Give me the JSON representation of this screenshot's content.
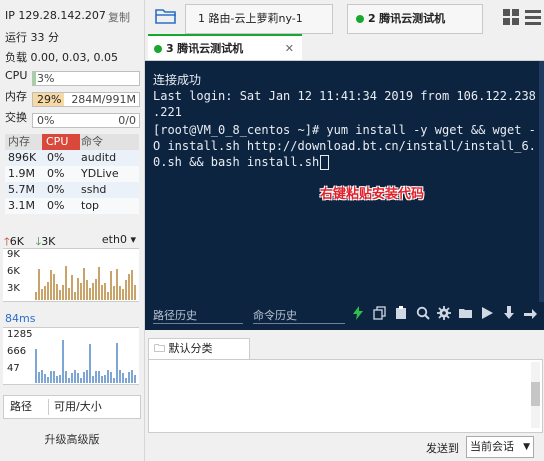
{
  "sidebar": {
    "ip_label": "IP 129.28.142.207",
    "copy_label": "复制",
    "uptime": "运行 33 分",
    "load": "负载 0.00, 0.03, 0.05",
    "cpu_label": "CPU",
    "cpu_value": "3%",
    "cpu_pct": 3,
    "mem_label": "内存",
    "mem_pct_text": "29%",
    "mem_pct": 29,
    "mem_size": "284M/991M",
    "swap_label": "交换",
    "swap_pct_text": "0%",
    "swap_size": "0/0",
    "proc_headers": [
      "内存",
      "CPU",
      "命令"
    ],
    "processes": [
      {
        "mem": "896K",
        "cpu": "0%",
        "cmd": "auditd"
      },
      {
        "mem": "1.9M",
        "cpu": "0%",
        "cmd": "YDLive"
      },
      {
        "mem": "5.7M",
        "cpu": "0%",
        "cmd": "sshd"
      },
      {
        "mem": "3.1M",
        "cpu": "0%",
        "cmd": "top"
      }
    ],
    "net_up": "6K",
    "net_down": "3K",
    "net_iface": "eth0",
    "net_ticks": [
      "9K",
      "6K",
      "3K"
    ],
    "latency_label": "84ms",
    "latency_ticks": [
      "1285",
      "666",
      "47"
    ],
    "disk_col1": "路径",
    "disk_col2": "可用/大小",
    "upgrade": "升级高级版"
  },
  "tabs": [
    {
      "number": "1",
      "label": "路由-云上萝莉ny-1",
      "active": false
    },
    {
      "number": "2",
      "label": "腾讯云测试机",
      "active": false
    }
  ],
  "active_tab": {
    "number": "3",
    "label": "腾讯云测试机"
  },
  "terminal": {
    "lines": [
      "连接成功",
      "Last login: Sat Jan 12 11:41:34 2019 from 106.122.238",
      ".221",
      "[root@VM_0_8_centos ~]# yum install -y wget && wget -",
      "O install.sh http://download.bt.cn/install/install_6.",
      "0.sh && bash install.sh"
    ],
    "overlay": "右键粘贴安装代码",
    "overlay_color": "#e0202a"
  },
  "toolbar": {
    "history_path": "路径历史",
    "history_cmd": "命令历史"
  },
  "commands": {
    "category": "默认分类",
    "send_to_label": "发送到",
    "send_target": "当前会话"
  },
  "colors": {
    "terminal_bg": "#0d2440",
    "accent_green": "#19a82f",
    "net_up": "#c0392b",
    "net_down": "#2e8b3a",
    "graph_bar": "#c8a36a",
    "latency_bar": "#7ea6d4",
    "latency_label": "#2a6fc9"
  }
}
